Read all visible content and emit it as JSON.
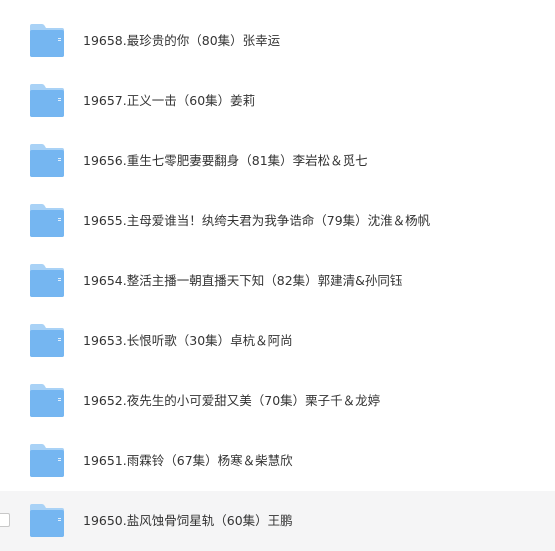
{
  "colors": {
    "folder_back": "#9ecbf4",
    "folder_front": "#72b4f0",
    "text": "#333333",
    "hover_row": "#f5f5f6"
  },
  "files": [
    {
      "name": "19658.最珍贵的你（80集）张幸运",
      "icon": "folder-icon"
    },
    {
      "name": "19657.正义一击（60集）姜莉",
      "icon": "folder-icon"
    },
    {
      "name": "19656.重生七零肥妻要翻身（81集）李岩松＆觅七",
      "icon": "folder-icon"
    },
    {
      "name": "19655.主母爱谁当！纨绔夫君为我争诰命（79集）沈淮＆杨帆",
      "icon": "folder-icon"
    },
    {
      "name": "19654.整活主播一朝直播天下知（82集）郭建清&孙同钰",
      "icon": "folder-icon"
    },
    {
      "name": "19653.长恨听歌（30集）卓杭＆阿尚",
      "icon": "folder-icon"
    },
    {
      "name": "19652.夜先生的小可爱甜又美（70集）栗子千＆龙婷",
      "icon": "folder-icon"
    },
    {
      "name": "19651.雨霖铃（67集）杨寒＆柴慧欣",
      "icon": "folder-icon"
    },
    {
      "name": "19650.盐风蚀骨饲星轨（60集）王鹏",
      "icon": "folder-icon"
    }
  ]
}
